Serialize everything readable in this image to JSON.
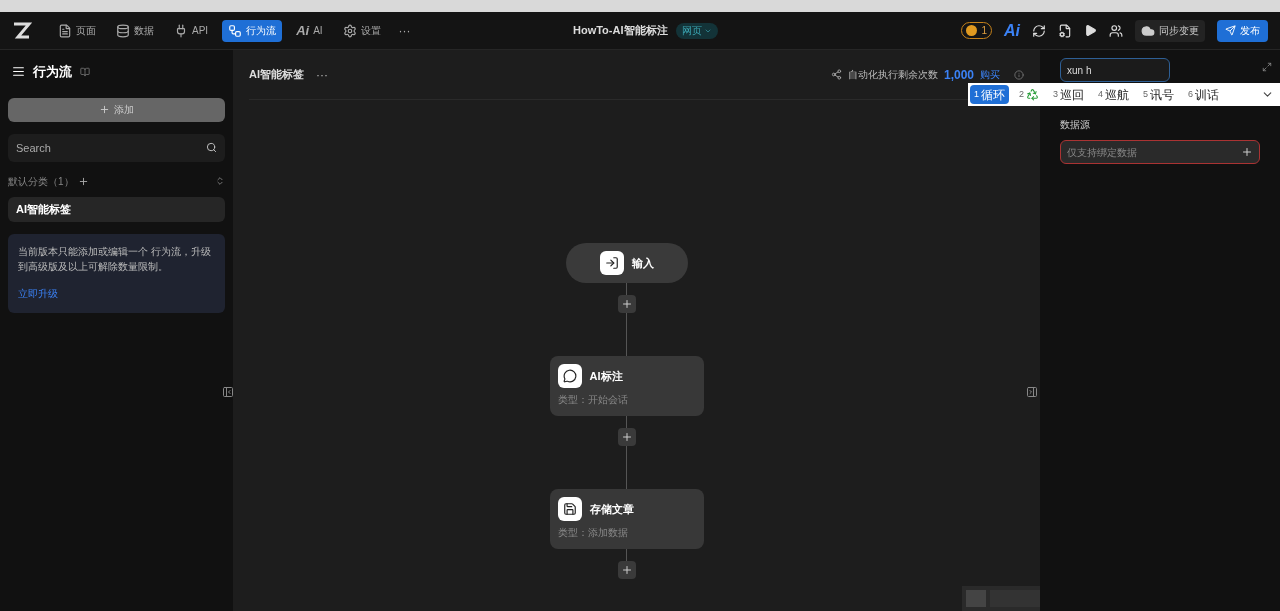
{
  "nav": {
    "items": [
      {
        "label": "页面",
        "selected": false
      },
      {
        "label": "数据",
        "selected": false
      },
      {
        "label": "API",
        "selected": false
      },
      {
        "label": "行为流",
        "selected": true
      },
      {
        "label": "AI",
        "mark": "Ai",
        "selected": false
      },
      {
        "label": "设置",
        "selected": false
      }
    ],
    "more": "···",
    "title": "HowTo-AI智能标注",
    "title_tag": "网页",
    "alert_count": "1",
    "ai_logo": "Ai",
    "sync": "同步变更",
    "publish": "发布"
  },
  "sidebar": {
    "title": "行为流",
    "add": "添加",
    "search_placeholder": "Search",
    "group": "默认分类（1）",
    "items": [
      {
        "label": "AI智能标签",
        "selected": true
      }
    ],
    "notice": "当前版本只能添加或编辑一个 行为流，升级到高级版及以上可解除数量限制。",
    "upgrade": "立即升级"
  },
  "canvas": {
    "title": "AI智能标签",
    "more": "···",
    "quota_label": "自动化执行剩余次数",
    "quota": "1,000",
    "buy": "购买",
    "nodes": [
      {
        "kind": "start",
        "title": "输入"
      },
      {
        "kind": "step",
        "title": "AI标注",
        "subtitle": "类型：开始会话"
      },
      {
        "kind": "step",
        "title": "存储文章",
        "subtitle": "类型：添加数据"
      }
    ]
  },
  "right_panel": {
    "input_value": "xun h",
    "section": "数据源",
    "field_placeholder": "仅支持绑定数据",
    "field_error": true
  },
  "ime": {
    "candidates": [
      {
        "index": "1",
        "kind": "text",
        "text": "循环",
        "selected": true
      },
      {
        "index": "2",
        "kind": "icon",
        "selected": false
      },
      {
        "index": "3",
        "kind": "text",
        "text": "巡回",
        "selected": false
      },
      {
        "index": "4",
        "kind": "text",
        "text": "巡航",
        "selected": false
      },
      {
        "index": "5",
        "kind": "text",
        "text": "讯号",
        "selected": false
      },
      {
        "index": "6",
        "kind": "text",
        "text": "训话",
        "selected": false
      }
    ]
  }
}
